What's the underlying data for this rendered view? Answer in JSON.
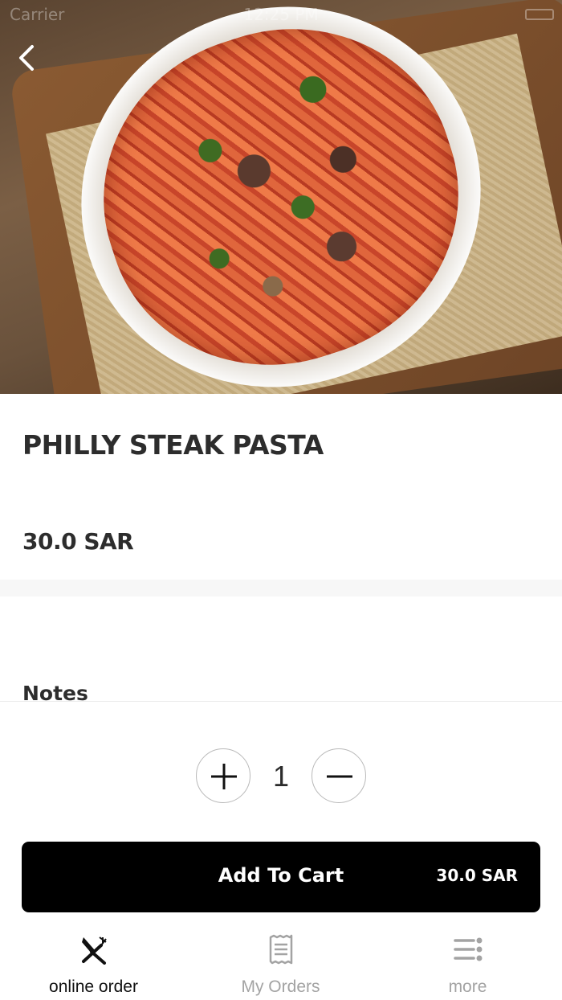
{
  "status_bar": {
    "carrier": "Carrier",
    "time": "12:25 PM"
  },
  "product": {
    "name": "PHILLY STEAK PASTA",
    "price": "30.0 SAR",
    "notes_label": "Notes"
  },
  "quantity": {
    "value": "1"
  },
  "cart": {
    "label": "Add To Cart",
    "price": "30.0 SAR"
  },
  "tabs": [
    {
      "label": "online order",
      "icon": "fork-knife-icon",
      "active": true
    },
    {
      "label": "My Orders",
      "icon": "receipt-icon",
      "active": false
    },
    {
      "label": "more",
      "icon": "menu-icon",
      "active": false
    }
  ],
  "colors": {
    "accent": "#000000",
    "active_tab": "#111111",
    "inactive_tab": "#a3a3a3"
  }
}
